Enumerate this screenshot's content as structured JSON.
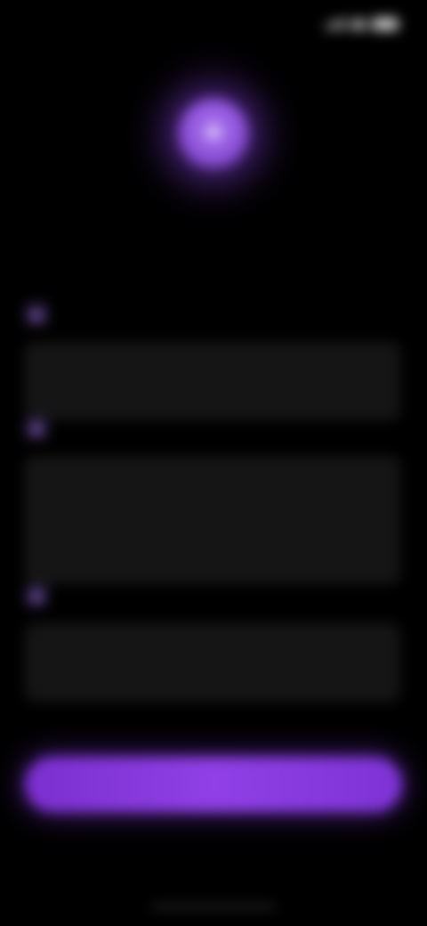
{
  "status_bar": {
    "time": "",
    "icons": [
      "signal-icon",
      "wifi-icon",
      "battery-icon"
    ]
  },
  "hero": {
    "icon": "sparkle-icon"
  },
  "title": "",
  "features": [
    {
      "icon": "feature-icon",
      "title": "",
      "body": ""
    },
    {
      "icon": "feature-icon",
      "title": "",
      "body": ""
    },
    {
      "icon": "feature-icon",
      "title": "",
      "body": ""
    }
  ],
  "primary_button": {
    "label": ""
  },
  "secondary_link": {
    "label": ""
  },
  "colors": {
    "background": "#000000",
    "accent": "#8a3fe0",
    "orb": "#9a5fe8"
  }
}
